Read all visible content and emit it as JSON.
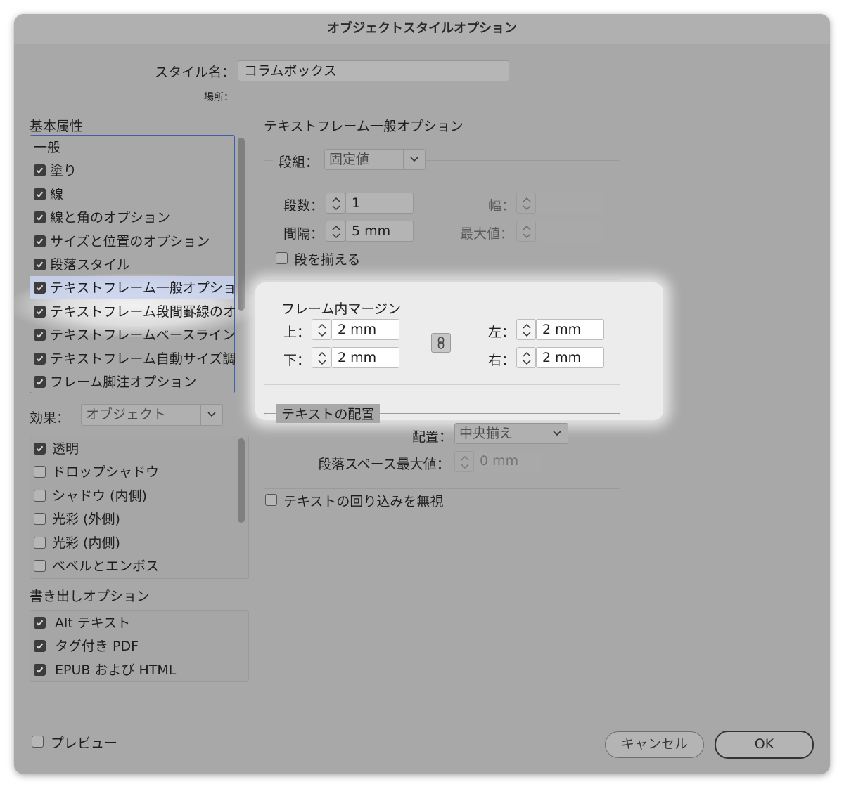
{
  "dialog": {
    "title": "オブジェクトスタイルオプション"
  },
  "style_name": {
    "label": "スタイル名：",
    "value": "コラムボックス",
    "location_label": "場所："
  },
  "basic_attributes": {
    "heading": "基本属性",
    "items": [
      {
        "label": "一般",
        "checkbox": false,
        "checked": false
      },
      {
        "label": "塗り",
        "checkbox": true,
        "checked": true
      },
      {
        "label": "線",
        "checkbox": true,
        "checked": true
      },
      {
        "label": "線と角のオプション",
        "checkbox": true,
        "checked": true
      },
      {
        "label": "サイズと位置のオプション",
        "checkbox": true,
        "checked": true
      },
      {
        "label": "段落スタイル",
        "checkbox": true,
        "checked": true
      },
      {
        "label": "テキストフレーム一般オプショ",
        "checkbox": true,
        "checked": true,
        "selected": true
      },
      {
        "label": "テキストフレーム段間罫線のオ",
        "checkbox": true,
        "checked": true
      },
      {
        "label": "テキストフレームベースライン",
        "checkbox": true,
        "checked": true
      },
      {
        "label": "テキストフレーム自動サイズ調",
        "checkbox": true,
        "checked": true
      },
      {
        "label": "フレーム脚注オプション",
        "checkbox": true,
        "checked": true
      }
    ]
  },
  "effects": {
    "label": "効果：",
    "select_value": "オブジェクト",
    "items": [
      {
        "label": "透明",
        "checked": true
      },
      {
        "label": "ドロップシャドウ",
        "checked": false
      },
      {
        "label": "シャドウ (内側)",
        "checked": false
      },
      {
        "label": "光彩 (外側)",
        "checked": false
      },
      {
        "label": "光彩 (内側)",
        "checked": false
      },
      {
        "label": "ベベルとエンボス",
        "checked": false
      }
    ]
  },
  "export_options": {
    "heading": "書き出しオプション",
    "items": [
      {
        "label": "Alt テキスト",
        "checked": true
      },
      {
        "label": "タグ付き PDF",
        "checked": true
      },
      {
        "label": "EPUB および HTML",
        "checked": true
      }
    ]
  },
  "preview": {
    "label": "プレビュー",
    "checked": false
  },
  "section": {
    "title": "テキストフレーム一般オプション"
  },
  "columns": {
    "label": "段組：",
    "select_value": "固定値",
    "count_label": "段数：",
    "count_value": "1",
    "gutter_label": "間隔：",
    "gutter_value": "5 mm",
    "width_label": "幅：",
    "width_value": "",
    "max_label": "最大値：",
    "max_value": "",
    "balance_label": "段を揃える",
    "balance_checked": false
  },
  "inset": {
    "title": "フレーム内マージン",
    "top_label": "上：",
    "top_value": "2 mm",
    "bottom_label": "下：",
    "bottom_value": "2 mm",
    "left_label": "左：",
    "left_value": "2 mm",
    "right_label": "右：",
    "right_value": "2 mm"
  },
  "vertical_justification": {
    "title": "テキストの配置",
    "align_label": "配置：",
    "align_value": "中央揃え",
    "para_spacing_label": "段落スペース最大値：",
    "para_spacing_value": "0 mm"
  },
  "ignore_wrap": {
    "label": "テキストの回り込みを無視",
    "checked": false
  },
  "buttons": {
    "cancel": "キャンセル",
    "ok": "OK"
  }
}
